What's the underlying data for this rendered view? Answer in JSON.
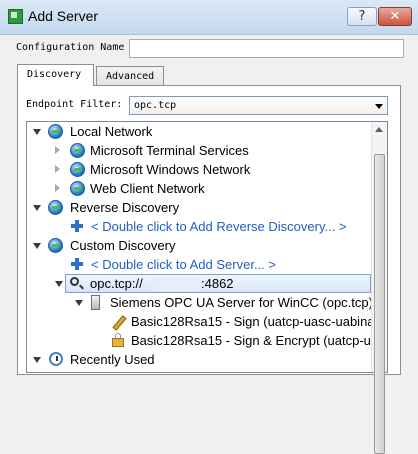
{
  "window": {
    "title": "Add Server",
    "help_label": "?",
    "close_label": "✕"
  },
  "config": {
    "label": "Configuration Name",
    "value": ""
  },
  "tabs": [
    {
      "label": "Discovery",
      "active": true
    },
    {
      "label": "Advanced",
      "active": false
    }
  ],
  "filter": {
    "label": "Endpoint Filter:",
    "value": "opc.tcp"
  },
  "tree": {
    "local_network": "Local Network",
    "terminal_services": "Microsoft Terminal Services",
    "windows_network": "Microsoft Windows Network",
    "web_client_network": "Web Client Network",
    "reverse_discovery": "Reverse Discovery",
    "add_reverse": "< Double click to Add Reverse Discovery... >",
    "custom_discovery": "Custom Discovery",
    "add_server": "< Double click to Add Server... >",
    "endpoint_prefix": "opc.tcp://",
    "endpoint_port": ":4862",
    "server_name": "Siemens OPC UA Server for WinCC (opc.tcp)",
    "sign_endpoint": "Basic128Rsa15 - Sign (uatcp-uasc-uabina",
    "sign_encrypt_endpoint": "Basic128Rsa15 - Sign & Encrypt (uatcp-u",
    "recently_used": "Recently Used"
  },
  "colors": {
    "link_blue": "#1f5fbf",
    "selection_border": "#7da2ce"
  }
}
